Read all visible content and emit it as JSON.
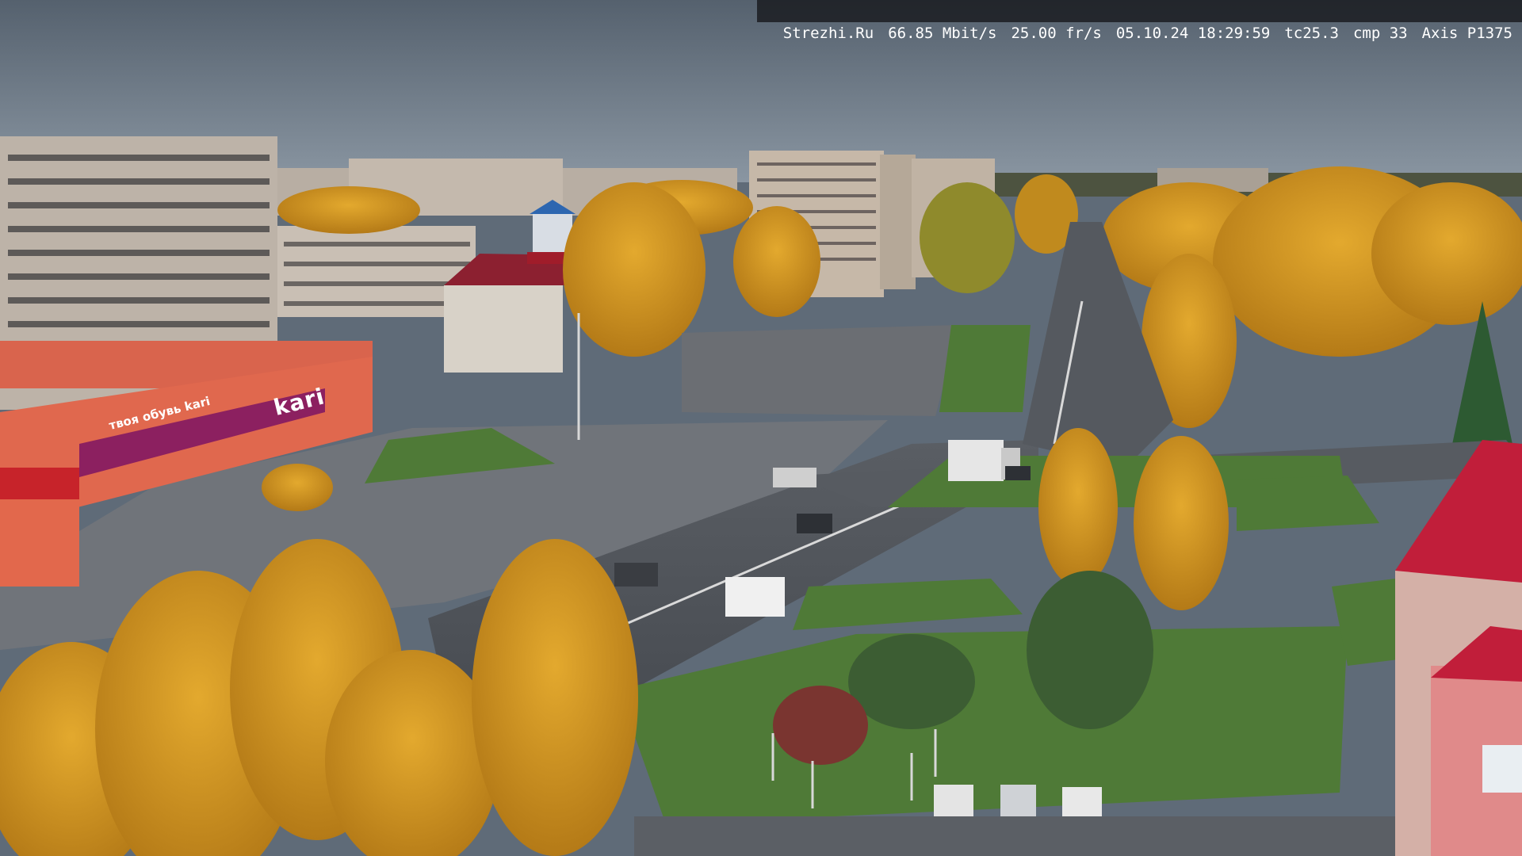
{
  "overlay": {
    "site": "Strezhi.Ru",
    "bitrate": "66.85 Mbit/s",
    "framerate": "25.00 fr/s",
    "datetime": "05.10.24 18:29:59",
    "tc": "tc25.3",
    "cmp": "cmp 33",
    "camera": "Axis P1375"
  },
  "signs": {
    "store_brand": "kari",
    "store_sub": "твоя обувь kari"
  },
  "colors": {
    "sky": "#6f7b88",
    "foliage": "#d69b23",
    "grass": "#4f7a37",
    "asphalt": "#4b4f55",
    "store_facade": "#e0684e",
    "store_band": "#8c2060",
    "roof_red": "#b4202a"
  }
}
